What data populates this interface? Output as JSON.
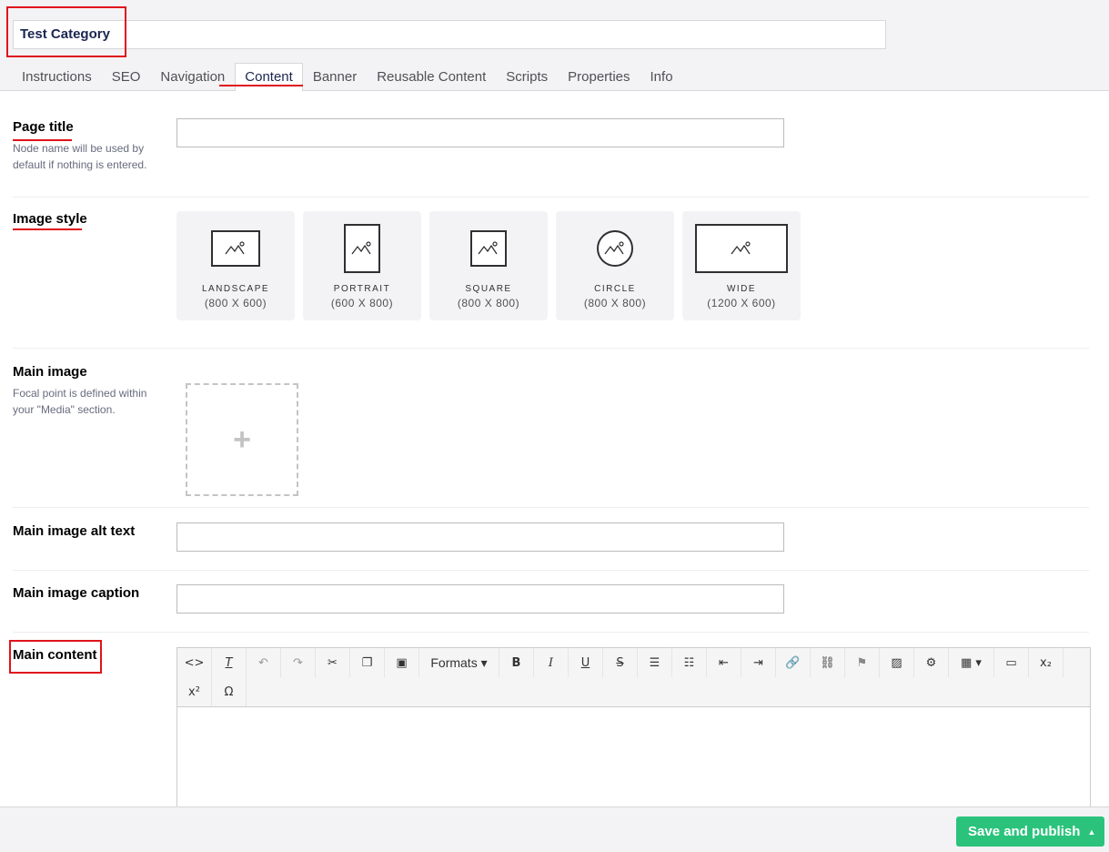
{
  "node": {
    "name": "Test Category"
  },
  "tabs": [
    {
      "label": "Instructions"
    },
    {
      "label": "SEO"
    },
    {
      "label": "Navigation"
    },
    {
      "label": "Content",
      "active": true
    },
    {
      "label": "Banner"
    },
    {
      "label": "Reusable Content"
    },
    {
      "label": "Scripts"
    },
    {
      "label": "Properties"
    },
    {
      "label": "Info"
    }
  ],
  "properties": {
    "page_title": {
      "label": "Page title",
      "description": "Node name will be used by default if nothing is entered.",
      "value": ""
    },
    "image_style": {
      "label": "Image style",
      "options": [
        {
          "name": "LANDSCAPE",
          "size": "(800 X 600)"
        },
        {
          "name": "PORTRAIT",
          "size": "(600 X 800)"
        },
        {
          "name": "SQUARE",
          "size": "(800 X 800)"
        },
        {
          "name": "CIRCLE",
          "size": "(800 X 800)"
        },
        {
          "name": "WIDE",
          "size": "(1200 X 600)"
        }
      ]
    },
    "main_image": {
      "label": "Main image",
      "description": "Focal point is defined within your \"Media\" section.",
      "add_icon": "+"
    },
    "main_image_alt": {
      "label": "Main image alt text",
      "value": ""
    },
    "main_image_caption": {
      "label": "Main image caption",
      "value": ""
    },
    "main_content": {
      "label": "Main content",
      "toolbar": {
        "formats_label": "Formats",
        "bold": "B",
        "italic": "I",
        "underline": "U",
        "strike": "S",
        "omega": "Ω"
      }
    }
  },
  "footer": {
    "save_label": "Save and publish",
    "caret": "▲"
  },
  "colors": {
    "primary": "#2bc37c",
    "highlight": "#e0131b",
    "navy": "#1b264f"
  }
}
